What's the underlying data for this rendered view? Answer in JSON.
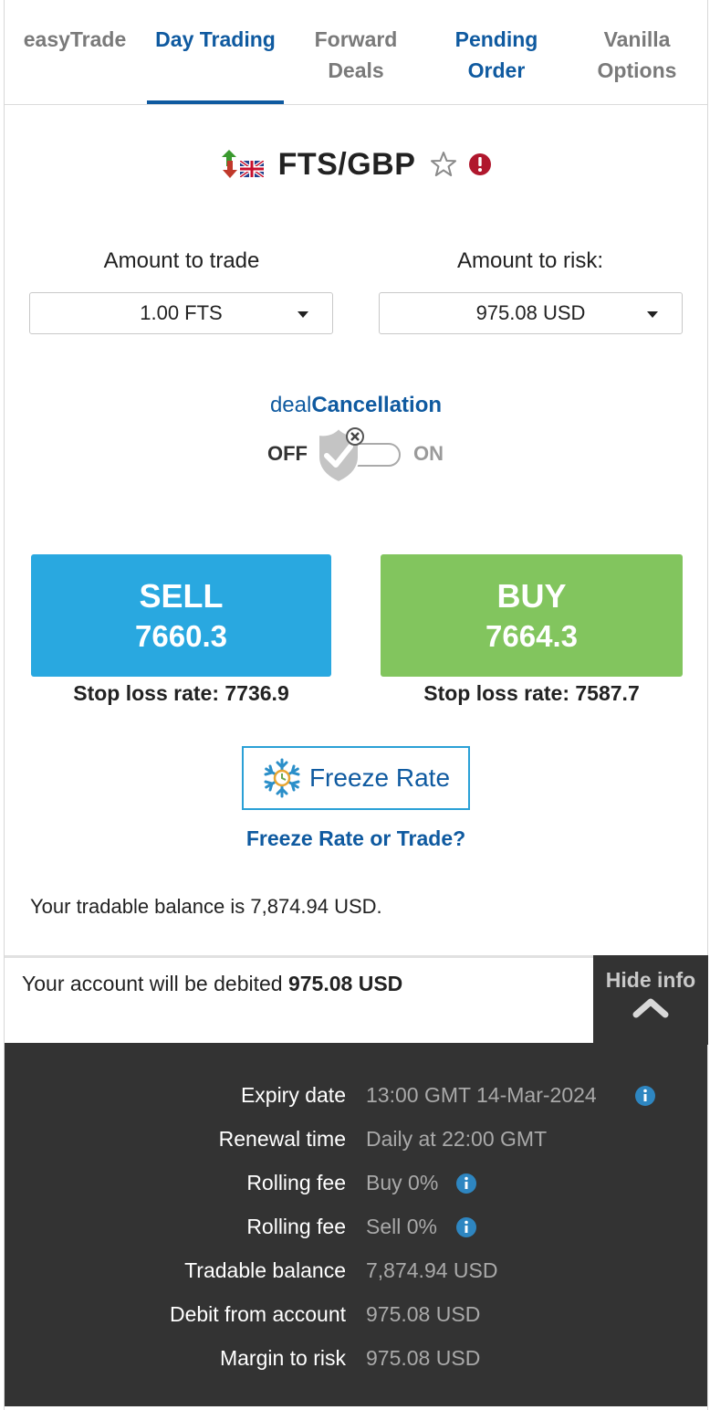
{
  "tabs": [
    {
      "label": "easyTrade"
    },
    {
      "label": "Day Trading"
    },
    {
      "label": "Forward Deals"
    },
    {
      "label": "Pending Order"
    },
    {
      "label": "Vanilla Options"
    }
  ],
  "instrument": {
    "name": "FTS/GBP",
    "flag_icon": "uk-flag-icon",
    "trend_icon": "up-down-arrows-icon"
  },
  "amount_trade": {
    "label": "Amount to trade",
    "value": "1.00 FTS"
  },
  "amount_risk": {
    "label": "Amount to risk:",
    "value": "975.08 USD"
  },
  "deal_cancellation": {
    "prefix": "deal",
    "suffix": "Cancellation",
    "off": "OFF",
    "on": "ON"
  },
  "sell": {
    "label": "SELL",
    "rate": "7660.3",
    "stop": "Stop loss rate: 7736.9"
  },
  "buy": {
    "label": "BUY",
    "rate": "7664.3",
    "stop": "Stop loss rate: 7587.7"
  },
  "freeze": {
    "button": "Freeze Rate",
    "link": "Freeze Rate or Trade?"
  },
  "balance_text": "Your tradable balance is 7,874.94 USD.",
  "debit": {
    "prefix": "Your account will be debited ",
    "amount": "975.08 USD"
  },
  "hide_info": "Hide info",
  "info_rows": [
    {
      "key": "Expiry date",
      "value": "13:00 GMT 14-Mar-2024",
      "has_info": true
    },
    {
      "key": "Renewal time",
      "value": "Daily at 22:00 GMT",
      "has_info": false
    },
    {
      "key": "Rolling fee",
      "value": "Buy 0%",
      "has_info": true
    },
    {
      "key": "Rolling fee",
      "value": "Sell 0%",
      "has_info": true
    },
    {
      "key": "Tradable balance",
      "value": "7,874.94 USD",
      "has_info": false
    },
    {
      "key": "Debit from account",
      "value": "975.08 USD",
      "has_info": false
    },
    {
      "key": "Margin to risk",
      "value": "975.08 USD",
      "has_info": false
    }
  ],
  "colors": {
    "brand_blue": "#0f5aa0",
    "sell": "#29a8e0",
    "buy": "#82c55e",
    "panel": "#333333",
    "alert": "#b0172d"
  }
}
